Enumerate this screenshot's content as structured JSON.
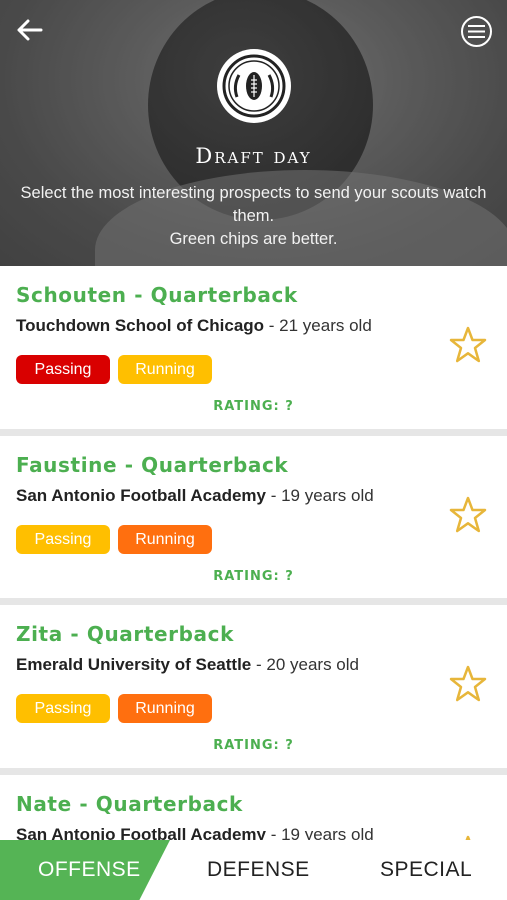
{
  "header": {
    "title": "Draft day",
    "subtitle_line1": "Select the most interesting prospects to send your scouts watch them.",
    "subtitle_line2": "Green chips are better."
  },
  "prospects": [
    {
      "name": "Schouten - Quarterback",
      "school": "Touchdown School of Chicago",
      "age": " - 21 years old",
      "chips": [
        {
          "label": "Passing",
          "color": "#d90000"
        },
        {
          "label": "Running",
          "color": "#ffbf00"
        }
      ],
      "rating": "RATING: ?"
    },
    {
      "name": "Faustine - Quarterback",
      "school": "San Antonio Football Academy",
      "age": " - 19 years old",
      "chips": [
        {
          "label": "Passing",
          "color": "#ffbf00"
        },
        {
          "label": "Running",
          "color": "#ff6f0f"
        }
      ],
      "rating": "RATING: ?"
    },
    {
      "name": "Zita - Quarterback",
      "school": "Emerald University of Seattle",
      "age": " - 20 years old",
      "chips": [
        {
          "label": "Passing",
          "color": "#ffbf00"
        },
        {
          "label": "Running",
          "color": "#ff6f0f"
        }
      ],
      "rating": "RATING: ?"
    },
    {
      "name": "Nate - Quarterback",
      "school": "San Antonio Football Academy",
      "age": " - 19 years old"
    }
  ],
  "tabs": {
    "offense": "OFFENSE",
    "defense": "DEFENSE",
    "special": "SPECIAL"
  },
  "colors": {
    "accent_green": "#4caf50",
    "star": "#e7b63a"
  }
}
